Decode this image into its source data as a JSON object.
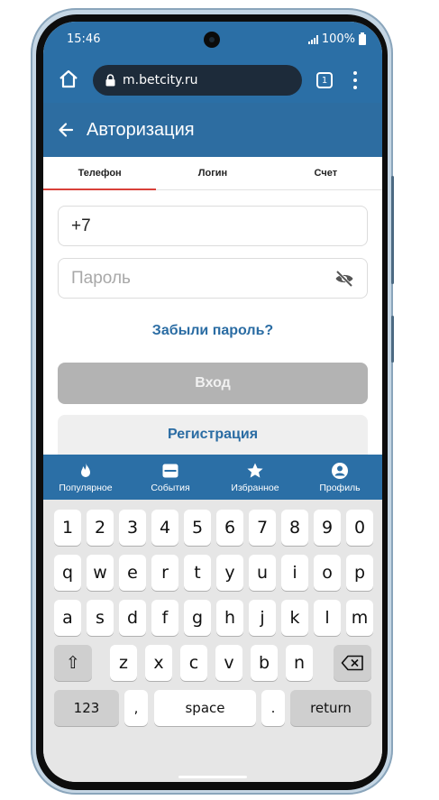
{
  "status_bar": {
    "time": "15:46",
    "battery": "100%"
  },
  "browser": {
    "url": "m.betcity.ru",
    "tab_count": "1"
  },
  "header": {
    "title": "Авторизация"
  },
  "auth_tabs": [
    {
      "label": "Телефон",
      "active": true
    },
    {
      "label": "Логин",
      "active": false
    },
    {
      "label": "Счет",
      "active": false
    }
  ],
  "form": {
    "phone_value": "+7",
    "password_placeholder": "Пароль",
    "forgot_link": "Забыли пароль?",
    "login_button": "Вход",
    "register_button": "Регистрация"
  },
  "bottom_nav": [
    {
      "label": "Популярное",
      "icon": "fire-icon"
    },
    {
      "label": "События",
      "icon": "events-icon"
    },
    {
      "label": "Избранное",
      "icon": "star-icon"
    },
    {
      "label": "Профиль",
      "icon": "profile-icon"
    }
  ],
  "keyboard": {
    "row1": [
      "1",
      "2",
      "3",
      "4",
      "5",
      "6",
      "7",
      "8",
      "9",
      "0"
    ],
    "row2": [
      "q",
      "w",
      "e",
      "r",
      "t",
      "y",
      "u",
      "i",
      "o",
      "p"
    ],
    "row3": [
      "a",
      "s",
      "d",
      "f",
      "g",
      "h",
      "j",
      "k",
      "l",
      "m"
    ],
    "row4": [
      "z",
      "x",
      "c",
      "v",
      "b",
      "n"
    ],
    "shift_label": "⇧",
    "numbers_label": "123",
    "comma_label": ",",
    "space_label": "space",
    "period_label": ".",
    "return_label": "return"
  },
  "colors": {
    "primary": "#2b6fa6",
    "link": "#2a6ca3",
    "active_tab_underline": "#d9413a",
    "disabled_button": "#b3b3b3"
  }
}
